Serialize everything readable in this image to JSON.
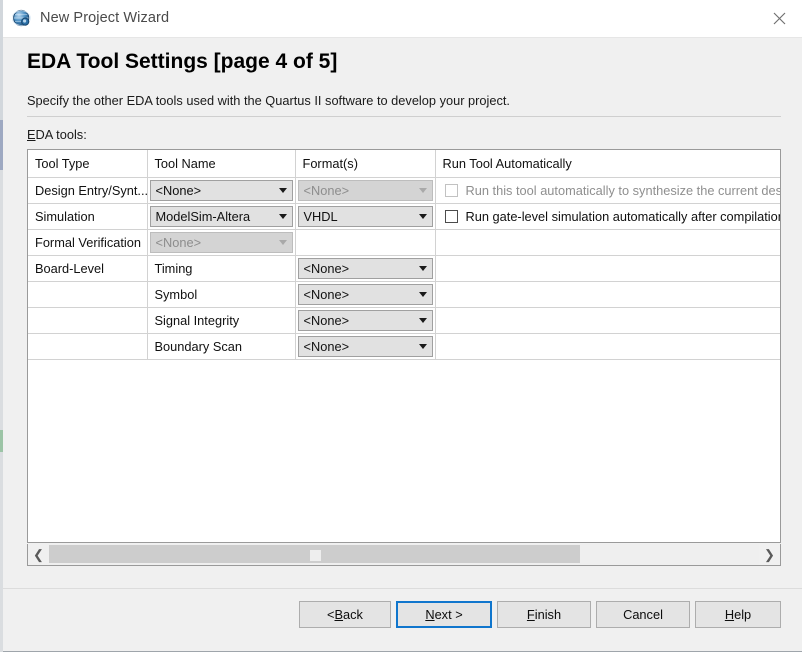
{
  "window": {
    "title": "New Project Wizard",
    "icon": "quartus-globe-icon",
    "close_label": "close-icon"
  },
  "page": {
    "title": "EDA Tool Settings [page 4 of 5]",
    "description": "Specify the other EDA tools used with the Quartus II software to develop your project.",
    "section_label_prefix": "E",
    "section_label_rest": "DA tools:"
  },
  "table": {
    "headers": {
      "tool_type": "Tool Type",
      "tool_name": "Tool Name",
      "formats": "Format(s)",
      "run_tool": "Run Tool Automatically"
    },
    "rows": [
      {
        "tool_type": "Design Entry/Synt...",
        "tool_name": "<None>",
        "tool_name_disabled": false,
        "format": "<None>",
        "format_disabled": true,
        "has_format_combo": true,
        "checkbox": {
          "label": "Run this tool automatically to synthesize the current desi",
          "checked": false,
          "disabled": true
        }
      },
      {
        "tool_type": "Simulation",
        "tool_name": "ModelSim-Altera",
        "tool_name_disabled": false,
        "format": "VHDL",
        "format_disabled": false,
        "has_format_combo": true,
        "checkbox": {
          "label": "Run gate-level simulation automatically after compilation",
          "checked": false,
          "disabled": false
        }
      },
      {
        "tool_type": "Formal Verification",
        "tool_name": "<None>",
        "tool_name_disabled": true,
        "format": "",
        "format_disabled": false,
        "has_format_combo": false,
        "checkbox": null
      },
      {
        "tool_type": "Board-Level",
        "tool_name": "Timing",
        "tool_name_plain": true,
        "format": "<None>",
        "format_disabled": false,
        "has_format_combo": true,
        "checkbox": null
      },
      {
        "tool_type": "",
        "tool_name": "Symbol",
        "tool_name_plain": true,
        "format": "<None>",
        "format_disabled": false,
        "has_format_combo": true,
        "checkbox": null
      },
      {
        "tool_type": "",
        "tool_name": "Signal Integrity",
        "tool_name_plain": true,
        "format": "<None>",
        "format_disabled": false,
        "has_format_combo": true,
        "checkbox": null
      },
      {
        "tool_type": "",
        "tool_name": "Boundary Scan",
        "tool_name_plain": true,
        "format": "<None>",
        "format_disabled": false,
        "has_format_combo": true,
        "checkbox": null
      }
    ]
  },
  "scrollbar": {
    "left_arrow": "❮",
    "right_arrow": "❯"
  },
  "buttons": {
    "back": {
      "pre": "< ",
      "mnemonic": "B",
      "post": "ack"
    },
    "next": {
      "pre": "",
      "mnemonic": "N",
      "post": "ext >"
    },
    "finish": {
      "pre": "",
      "mnemonic": "F",
      "post": "inish"
    },
    "cancel": {
      "label": "Cancel"
    },
    "help": {
      "pre": "",
      "mnemonic": "H",
      "post": "elp"
    }
  },
  "colors": {
    "accent": "#1076cd",
    "window_bg": "#f0f0f0",
    "field_bg": "#e1e1e1",
    "disabled_text": "#8d8d8d"
  }
}
